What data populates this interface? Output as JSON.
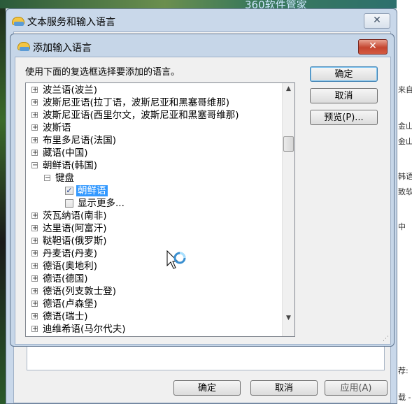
{
  "background": {
    "top_text": "360软件管家",
    "right_texts": [
      "来自",
      "金山",
      "金山",
      "韩语",
      "致软",
      "中",
      "荐:",
      "载 -"
    ]
  },
  "outer_window": {
    "title": "文本服务和输入语言",
    "close_label": "✕",
    "buttons": {
      "ok": "确定",
      "cancel": "取消",
      "apply": "应用(A)"
    }
  },
  "dialog": {
    "title": "添加输入语言",
    "close_label": "✕",
    "instruction": "使用下面的复选框选择要添加的语言。",
    "buttons": {
      "ok": "确定",
      "cancel": "取消",
      "preview": "预览(P)..."
    },
    "tree": [
      {
        "label": "波兰语(波兰)"
      },
      {
        "label": "波斯尼亚语(拉丁语，波斯尼亚和黑塞哥维那)"
      },
      {
        "label": "波斯尼亚语(西里尔文，波斯尼亚和黑塞哥维那)"
      },
      {
        "label": "波斯语"
      },
      {
        "label": "布里多尼语(法国)"
      },
      {
        "label": "藏语(中国)"
      },
      {
        "label": "朝鲜语(韩国)"
      },
      {
        "label": "键盘"
      },
      {
        "label": "朝鲜语"
      },
      {
        "label": "显示更多..."
      },
      {
        "label": "茨瓦纳语(南非)"
      },
      {
        "label": "达里语(阿富汗)"
      },
      {
        "label": "鞑靼语(俄罗斯)"
      },
      {
        "label": "丹麦语(丹麦)"
      },
      {
        "label": "德语(奥地利)"
      },
      {
        "label": "德语(德国)"
      },
      {
        "label": "德语(列支敦士登)"
      },
      {
        "label": "德语(卢森堡)"
      },
      {
        "label": "德语(瑞士)"
      },
      {
        "label": "迪维希语(马尔代夫)"
      }
    ]
  }
}
